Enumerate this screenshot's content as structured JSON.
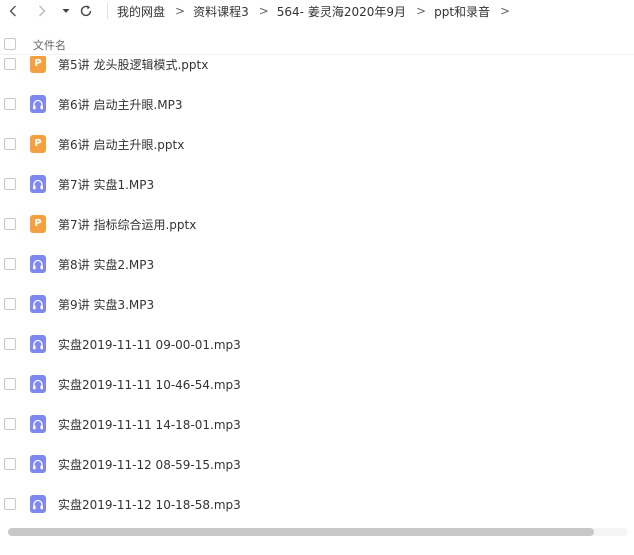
{
  "breadcrumb": [
    "我的网盘",
    "资料课程3",
    "564- 姜灵海2020年9月",
    "ppt和录音"
  ],
  "breadcrumb_sep": ">",
  "header": {
    "column_name": "文件名"
  },
  "icons": {
    "back": "chevron-left-icon",
    "forward": "chevron-right-icon",
    "history": "caret-down-icon",
    "refresh": "refresh-icon",
    "audio": "headphones-icon",
    "ppt": "ppt-file-icon"
  },
  "ppt_glyph": "P",
  "colors": {
    "audio": "#7f87f0",
    "ppt": "#f4a041"
  },
  "files": [
    {
      "type": "ppt",
      "name": "第5讲  龙头股逻辑模式.pptx"
    },
    {
      "type": "audio",
      "name": "第6讲  启动主升眼.MP3"
    },
    {
      "type": "ppt",
      "name": "第6讲  启动主升眼.pptx"
    },
    {
      "type": "audio",
      "name": "第7讲  实盘1.MP3"
    },
    {
      "type": "ppt",
      "name": "第7讲  指标综合运用.pptx"
    },
    {
      "type": "audio",
      "name": "第8讲  实盘2.MP3"
    },
    {
      "type": "audio",
      "name": "第9讲  实盘3.MP3"
    },
    {
      "type": "audio",
      "name": "实盘2019-11-11 09-00-01.mp3"
    },
    {
      "type": "audio",
      "name": "实盘2019-11-11 10-46-54.mp3"
    },
    {
      "type": "audio",
      "name": "实盘2019-11-11 14-18-01.mp3"
    },
    {
      "type": "audio",
      "name": "实盘2019-11-12 08-59-15.mp3"
    },
    {
      "type": "audio",
      "name": "实盘2019-11-12 10-18-58.mp3"
    }
  ]
}
